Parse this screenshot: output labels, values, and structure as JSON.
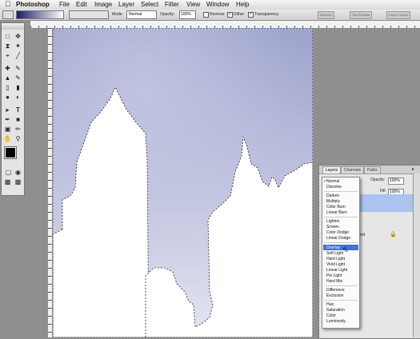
{
  "menubar": {
    "apple": "",
    "items": [
      "Photoshop",
      "File",
      "Edit",
      "Image",
      "Layer",
      "Select",
      "Filter",
      "View",
      "Window",
      "Help"
    ]
  },
  "options": {
    "mode_label": "Mode:",
    "mode_value": "Normal",
    "opacity_label": "Opacity:",
    "opacity_value": "100%",
    "reverse_label": "Reverse",
    "dither_label": "Dither",
    "transparency_label": "Transparency",
    "wells": [
      "Brushes",
      "Tool Presets",
      "Layer Comps"
    ]
  },
  "layers_panel": {
    "tabs": [
      "Layers",
      "Channels",
      "Paths"
    ],
    "opacity_label": "Opacity:",
    "opacity_value": "100%",
    "fill_label": "Fill:",
    "fill_value": "100%",
    "layer_name": "ound"
  },
  "blend_modes": {
    "groups": [
      [
        "Normal",
        "Dissolve"
      ],
      [
        "Darken",
        "Multiply",
        "Color Burn",
        "Linear Burn"
      ],
      [
        "Lighten",
        "Screen",
        "Color Dodge",
        "Linear Dodge"
      ],
      [
        "Overlay",
        "Soft Light",
        "Hard Light",
        "Vivid Light",
        "Linear Light",
        "Pin Light",
        "Hard Mix"
      ],
      [
        "Difference",
        "Exclusion"
      ],
      [
        "Hue",
        "Saturation",
        "Color",
        "Luminosity"
      ]
    ],
    "checked": "Normal",
    "highlighted": "Overlay"
  },
  "colors": {
    "sky_top": "#9da3cd",
    "sky_bottom": "#dfe1ef",
    "highlight": "#3d73d6"
  }
}
